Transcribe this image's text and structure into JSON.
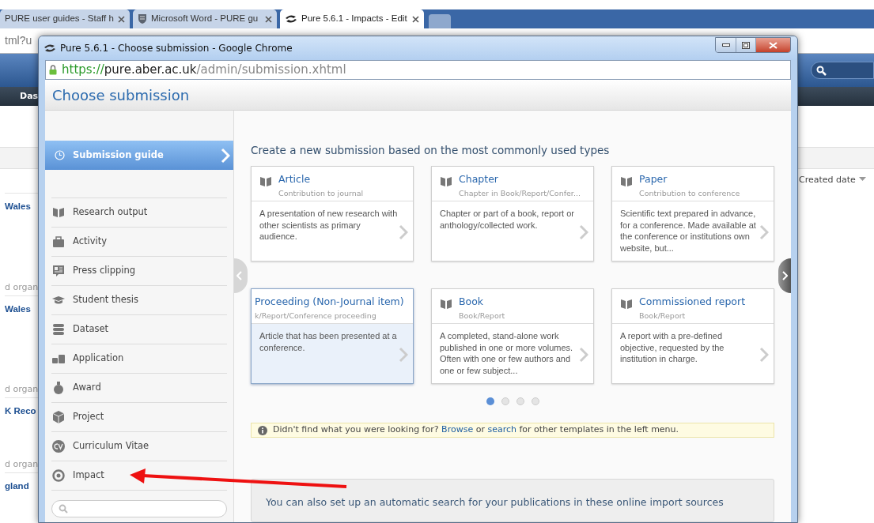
{
  "browser": {
    "tabs": [
      {
        "title": "PURE user guides - Staff h",
        "selected": false
      },
      {
        "title": "Microsoft Word - PURE gu",
        "selected": false
      },
      {
        "title": "Pure 5.6.1 - Impacts - Edit",
        "selected": true
      }
    ],
    "address": "tml?u"
  },
  "background_page": {
    "nav_label": "Das",
    "column_header": "Created date",
    "records": [
      {
        "title": "Wales",
        "meta": "d organ"
      },
      {
        "title": "Wales",
        "meta": "d organ"
      },
      {
        "title": "K Reco",
        "meta": "d organ"
      },
      {
        "title": "gland"
      }
    ]
  },
  "popup": {
    "title": "Pure 5.6.1 - Choose submission - Google Chrome",
    "url": {
      "scheme": "https://",
      "host": "pure.aber.ac.uk",
      "path": "/admin/submission.xhtml"
    },
    "heading": "Choose submission",
    "sidebar": {
      "guide": {
        "label": "Submission guide",
        "selected": true
      },
      "items": [
        {
          "label": "Research output",
          "selected": false
        },
        {
          "label": "Activity",
          "selected": false
        },
        {
          "label": "Press clipping",
          "selected": false
        },
        {
          "label": "Student thesis",
          "selected": false
        },
        {
          "label": "Dataset",
          "selected": false
        },
        {
          "label": "Application",
          "selected": false
        },
        {
          "label": "Award",
          "selected": false
        },
        {
          "label": "Project",
          "selected": false
        },
        {
          "label": "Curriculum Vitae",
          "selected": false
        },
        {
          "label": "Impact",
          "selected": false
        }
      ]
    },
    "main": {
      "heading": "Create a new submission based on the most commonly used types",
      "cards": [
        {
          "title": "Article",
          "subtitle": "Contribution to journal",
          "description": "A presentation of new research with other scientists as primary audience.",
          "selected": false,
          "scrolled": false
        },
        {
          "title": "Chapter",
          "subtitle": "Chapter in Book/Report/Confer...",
          "description": "Chapter or part of a book, report or anthology/collected work.",
          "selected": false,
          "scrolled": false
        },
        {
          "title": "Paper",
          "subtitle": "Contribution to conference",
          "description": "Scientific text prepared in advance, for a conference. Made available at the conference or institutions own website, but...",
          "selected": false,
          "scrolled": false
        },
        {
          "title": "Proceeding (Non-Journal item)",
          "subtitle": "k/Report/Conference proceeding",
          "description": "Article that has been presented at a conference.",
          "selected": true,
          "scrolled": true
        },
        {
          "title": "Book",
          "subtitle": "Book/Report",
          "description": "A completed, stand-alone work published in one or more volumes. Often with one or few authors and one or few subject...",
          "selected": false,
          "scrolled": false
        },
        {
          "title": "Commissioned report",
          "subtitle": "Book/Report",
          "description": "A report with a pre-defined objective, requested by the institution in charge.",
          "selected": false,
          "scrolled": false
        }
      ],
      "dots": [
        {
          "selected": true
        },
        {
          "selected": false
        },
        {
          "selected": false
        },
        {
          "selected": false
        }
      ],
      "info": [
        {
          "kind": "text",
          "text": "Didn't find what you were looking for? "
        },
        {
          "kind": "link",
          "text": "Browse"
        },
        {
          "kind": "text",
          "text": " or "
        },
        {
          "kind": "link",
          "text": "search"
        },
        {
          "kind": "text",
          "text": " for other templates in the left menu."
        }
      ],
      "import_text": "You can also set up an automatic search for your publications in these online import sources"
    }
  }
}
